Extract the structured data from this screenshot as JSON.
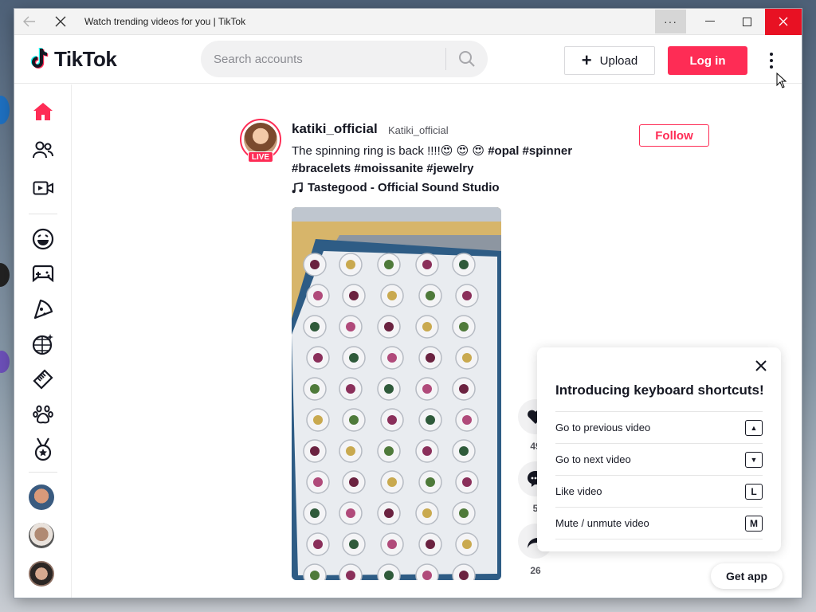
{
  "window": {
    "title": "Watch trending videos for you | TikTok",
    "more_label": "···",
    "minimize_label": "—",
    "maximize_label": "☐",
    "close_label": "✕"
  },
  "header": {
    "logo_text": "TikTok",
    "search_placeholder": "Search accounts",
    "upload_label": "Upload",
    "login_label": "Log in"
  },
  "sidebar": {
    "items": [
      {
        "name": "home",
        "icon": "home-icon",
        "active": true
      },
      {
        "name": "following",
        "icon": "following-icon"
      },
      {
        "name": "live",
        "icon": "live-video-icon"
      },
      {
        "name": "comedy",
        "icon": "smile-icon"
      },
      {
        "name": "gaming",
        "icon": "gamepad-icon"
      },
      {
        "name": "food",
        "icon": "pizza-icon"
      },
      {
        "name": "dance",
        "icon": "disco-ball-icon"
      },
      {
        "name": "beauty",
        "icon": "comb-icon"
      },
      {
        "name": "animals",
        "icon": "paw-icon"
      },
      {
        "name": "sports",
        "icon": "medal-icon"
      }
    ],
    "accounts": [
      "account-avatar-1",
      "account-avatar-2",
      "account-avatar-3"
    ]
  },
  "post": {
    "live_badge": "LIVE",
    "username": "katiki_official",
    "nickname": "Katiki_official",
    "caption_text": "The spinning ring is back !!!!",
    "caption_emojis": "😍 😍 😍",
    "tags": [
      "#opal",
      "#spinner",
      "#bracelets",
      "#moissanite",
      "#jewelry"
    ],
    "music": "Tastegood - Official Sound Studio",
    "follow_label": "Follow",
    "actions": [
      {
        "name": "like",
        "count": "49"
      },
      {
        "name": "comment",
        "count": "5"
      },
      {
        "name": "share",
        "count": "26"
      }
    ]
  },
  "shortcuts": {
    "title": "Introducing keyboard shortcuts!",
    "items": [
      {
        "label": "Go to previous video",
        "key": "▲"
      },
      {
        "label": "Go to next video",
        "key": "▼"
      },
      {
        "label": "Like video",
        "key": "L"
      },
      {
        "label": "Mute / unmute video",
        "key": "M"
      }
    ]
  },
  "get_app_label": "Get app",
  "colors": {
    "brand": "#fe2c55",
    "text": "#161823",
    "close": "#e81123"
  }
}
